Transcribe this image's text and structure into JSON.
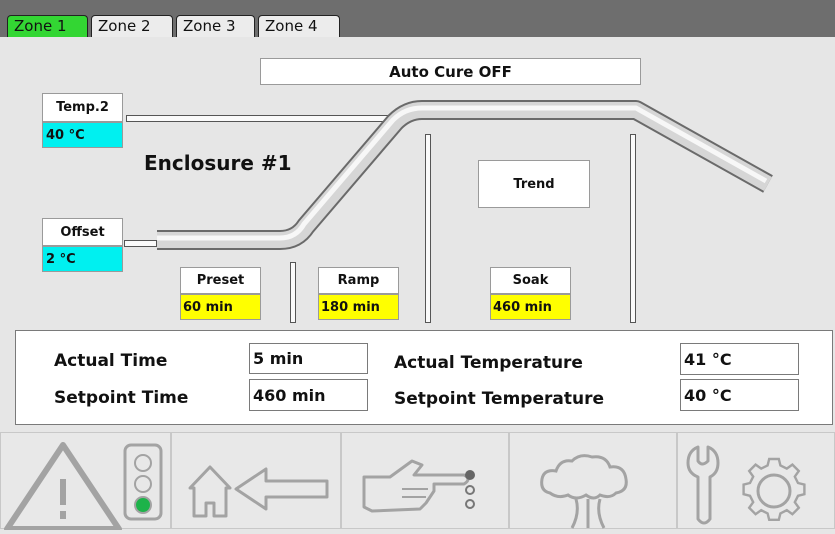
{
  "tabs": [
    {
      "label": "Zone 1",
      "active": true
    },
    {
      "label": "Zone 2",
      "active": false
    },
    {
      "label": "Zone 3",
      "active": false
    },
    {
      "label": "Zone 4",
      "active": false
    }
  ],
  "status_banner": "Auto Cure OFF",
  "enclosure_title": "Enclosure #1",
  "temp2": {
    "label": "Temp.2",
    "value": "40 °C"
  },
  "offset": {
    "label": "Offset",
    "value": "2 °C"
  },
  "trend_button": "Trend",
  "preset": {
    "label": "Preset",
    "value": "60 min"
  },
  "ramp": {
    "label": "Ramp",
    "value": "180 min"
  },
  "soak": {
    "label": "Soak",
    "value": "460 min"
  },
  "info": {
    "actual_time_label": "Actual Time",
    "actual_time_value": "5 min",
    "setpoint_time_label": "Setpoint Time",
    "setpoint_time_value": "460 min",
    "actual_temp_label": "Actual Temperature",
    "actual_temp_value": "41 °C",
    "setpoint_temp_label": "Setpoint Temperature",
    "setpoint_temp_value": "40 °C"
  },
  "bottom_buttons": [
    {
      "icon": "warning-traffic-light-icon"
    },
    {
      "icon": "home-back-icon"
    },
    {
      "icon": "pointing-hand-icon"
    },
    {
      "icon": "steam-cloud-icon"
    },
    {
      "icon": "wrench-gear-icon"
    }
  ],
  "colors": {
    "active_tab": "#33d633",
    "value_cyan": "#00f0f0",
    "value_yellow": "#ffff00",
    "traffic_light_green": "#1db34a"
  }
}
